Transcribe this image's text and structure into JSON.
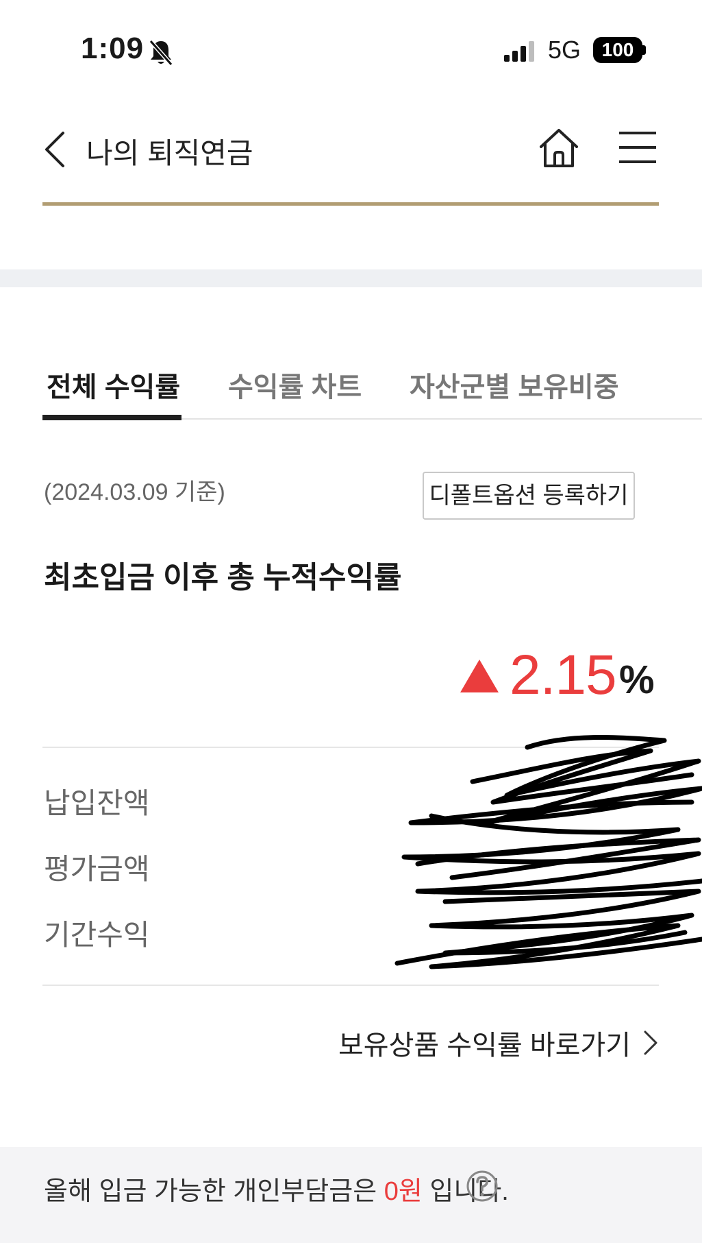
{
  "status_bar": {
    "time": "1:09",
    "network": "5G",
    "battery": "100",
    "icons": [
      "bell-slash-icon",
      "cellular-signal-icon",
      "battery-icon"
    ]
  },
  "header": {
    "title": "나의 퇴직연금",
    "icons": [
      "back-chevron-icon",
      "home-icon",
      "hamburger-menu-icon"
    ],
    "accent_color": "#b19d72"
  },
  "tabs": [
    {
      "label": "전체 수익률",
      "active": true
    },
    {
      "label": "수익률 차트",
      "active": false
    },
    {
      "label": "자산군별 보유비중",
      "active": false
    }
  ],
  "summary": {
    "base_date": "(2024.03.09 기준)",
    "default_option_button": "디폴트옵션 등록하기",
    "title": "최초입금 이후 총 누적수익률",
    "return_value": "2.15",
    "return_unit": "%",
    "return_color": "#ea3d3d",
    "rows": [
      {
        "label": "납입잔액",
        "value": ""
      },
      {
        "label": "평가금액",
        "value": ""
      },
      {
        "label": "기간수익",
        "value": ""
      }
    ],
    "shortcut_label": "보유상품 수익률 바로가기"
  },
  "footer": {
    "text_before": "올해 입금 가능한 개인부담금은 ",
    "amount": "0원",
    "text_after": " 입니다.",
    "help_icon": "question-circle-icon"
  }
}
